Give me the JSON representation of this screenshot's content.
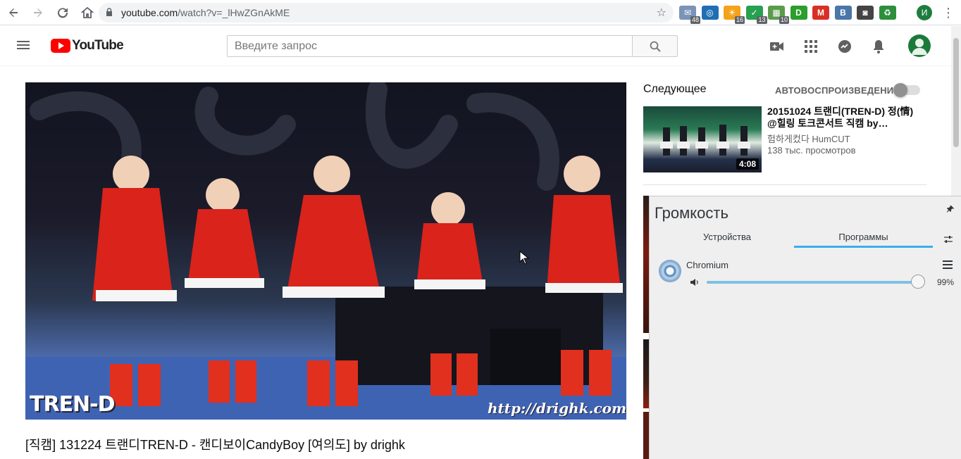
{
  "browser": {
    "url_domain": "youtube.com",
    "url_path": "/watch?v=_lHwZGnAkME",
    "extensions": [
      {
        "name": "mail-extension-icon",
        "glyph": "✉",
        "color": "#7a93b6",
        "badge": "48"
      },
      {
        "name": "speed-dial-icon",
        "glyph": "◎",
        "color": "#1f6fb5",
        "badge": ""
      },
      {
        "name": "weather-icon",
        "glyph": "☀",
        "color": "#f4a21a",
        "badge": "16"
      },
      {
        "name": "shield-icon",
        "glyph": "✓",
        "color": "#27a04f",
        "badge": "13"
      },
      {
        "name": "calendar-icon",
        "glyph": "▦",
        "color": "#5b9b4c",
        "badge": "10"
      },
      {
        "name": "pocket-icon",
        "glyph": "D",
        "color": "#2b9e2b",
        "badge": ""
      },
      {
        "name": "gmail-icon",
        "glyph": "M",
        "color": "#d93025",
        "badge": ""
      },
      {
        "name": "vk-icon",
        "glyph": "B",
        "color": "#4a76a8",
        "badge": ""
      },
      {
        "name": "camera-icon",
        "glyph": "◙",
        "color": "#444444",
        "badge": ""
      },
      {
        "name": "recycle-icon",
        "glyph": "♻",
        "color": "#2d8f3c",
        "badge": ""
      }
    ],
    "profile_initial": "И"
  },
  "youtube": {
    "logo_text": "YouTube",
    "search_placeholder": "Введите запрос",
    "video_title": "[직캠] 131224 트랜디TREN-D - 캔디보이CandyBoy [여의도] by drighk",
    "watermark_left": "TREN-D",
    "watermark_right": "http://drighk.com",
    "up_next_label": "Следующее",
    "autoplay_label": "АВТОВОСПРОИЗВЕДЕНИЕ",
    "autoplay_on": false,
    "recommendation": {
      "title": "20151024 트랜디(TREN-D) 정(情) @힐링 토크콘서트 직캠 by…",
      "channel": "험하게컸다 HumCUT",
      "views": "138 тыс. просмотров",
      "duration": "4:08"
    }
  },
  "volume_panel": {
    "title": "Громкость",
    "tabs": [
      {
        "label": "Устройства",
        "active": false
      },
      {
        "label": "Программы",
        "active": true
      }
    ],
    "app": {
      "name": "Chromium",
      "volume_percent": 99,
      "volume_text": "99%"
    }
  }
}
